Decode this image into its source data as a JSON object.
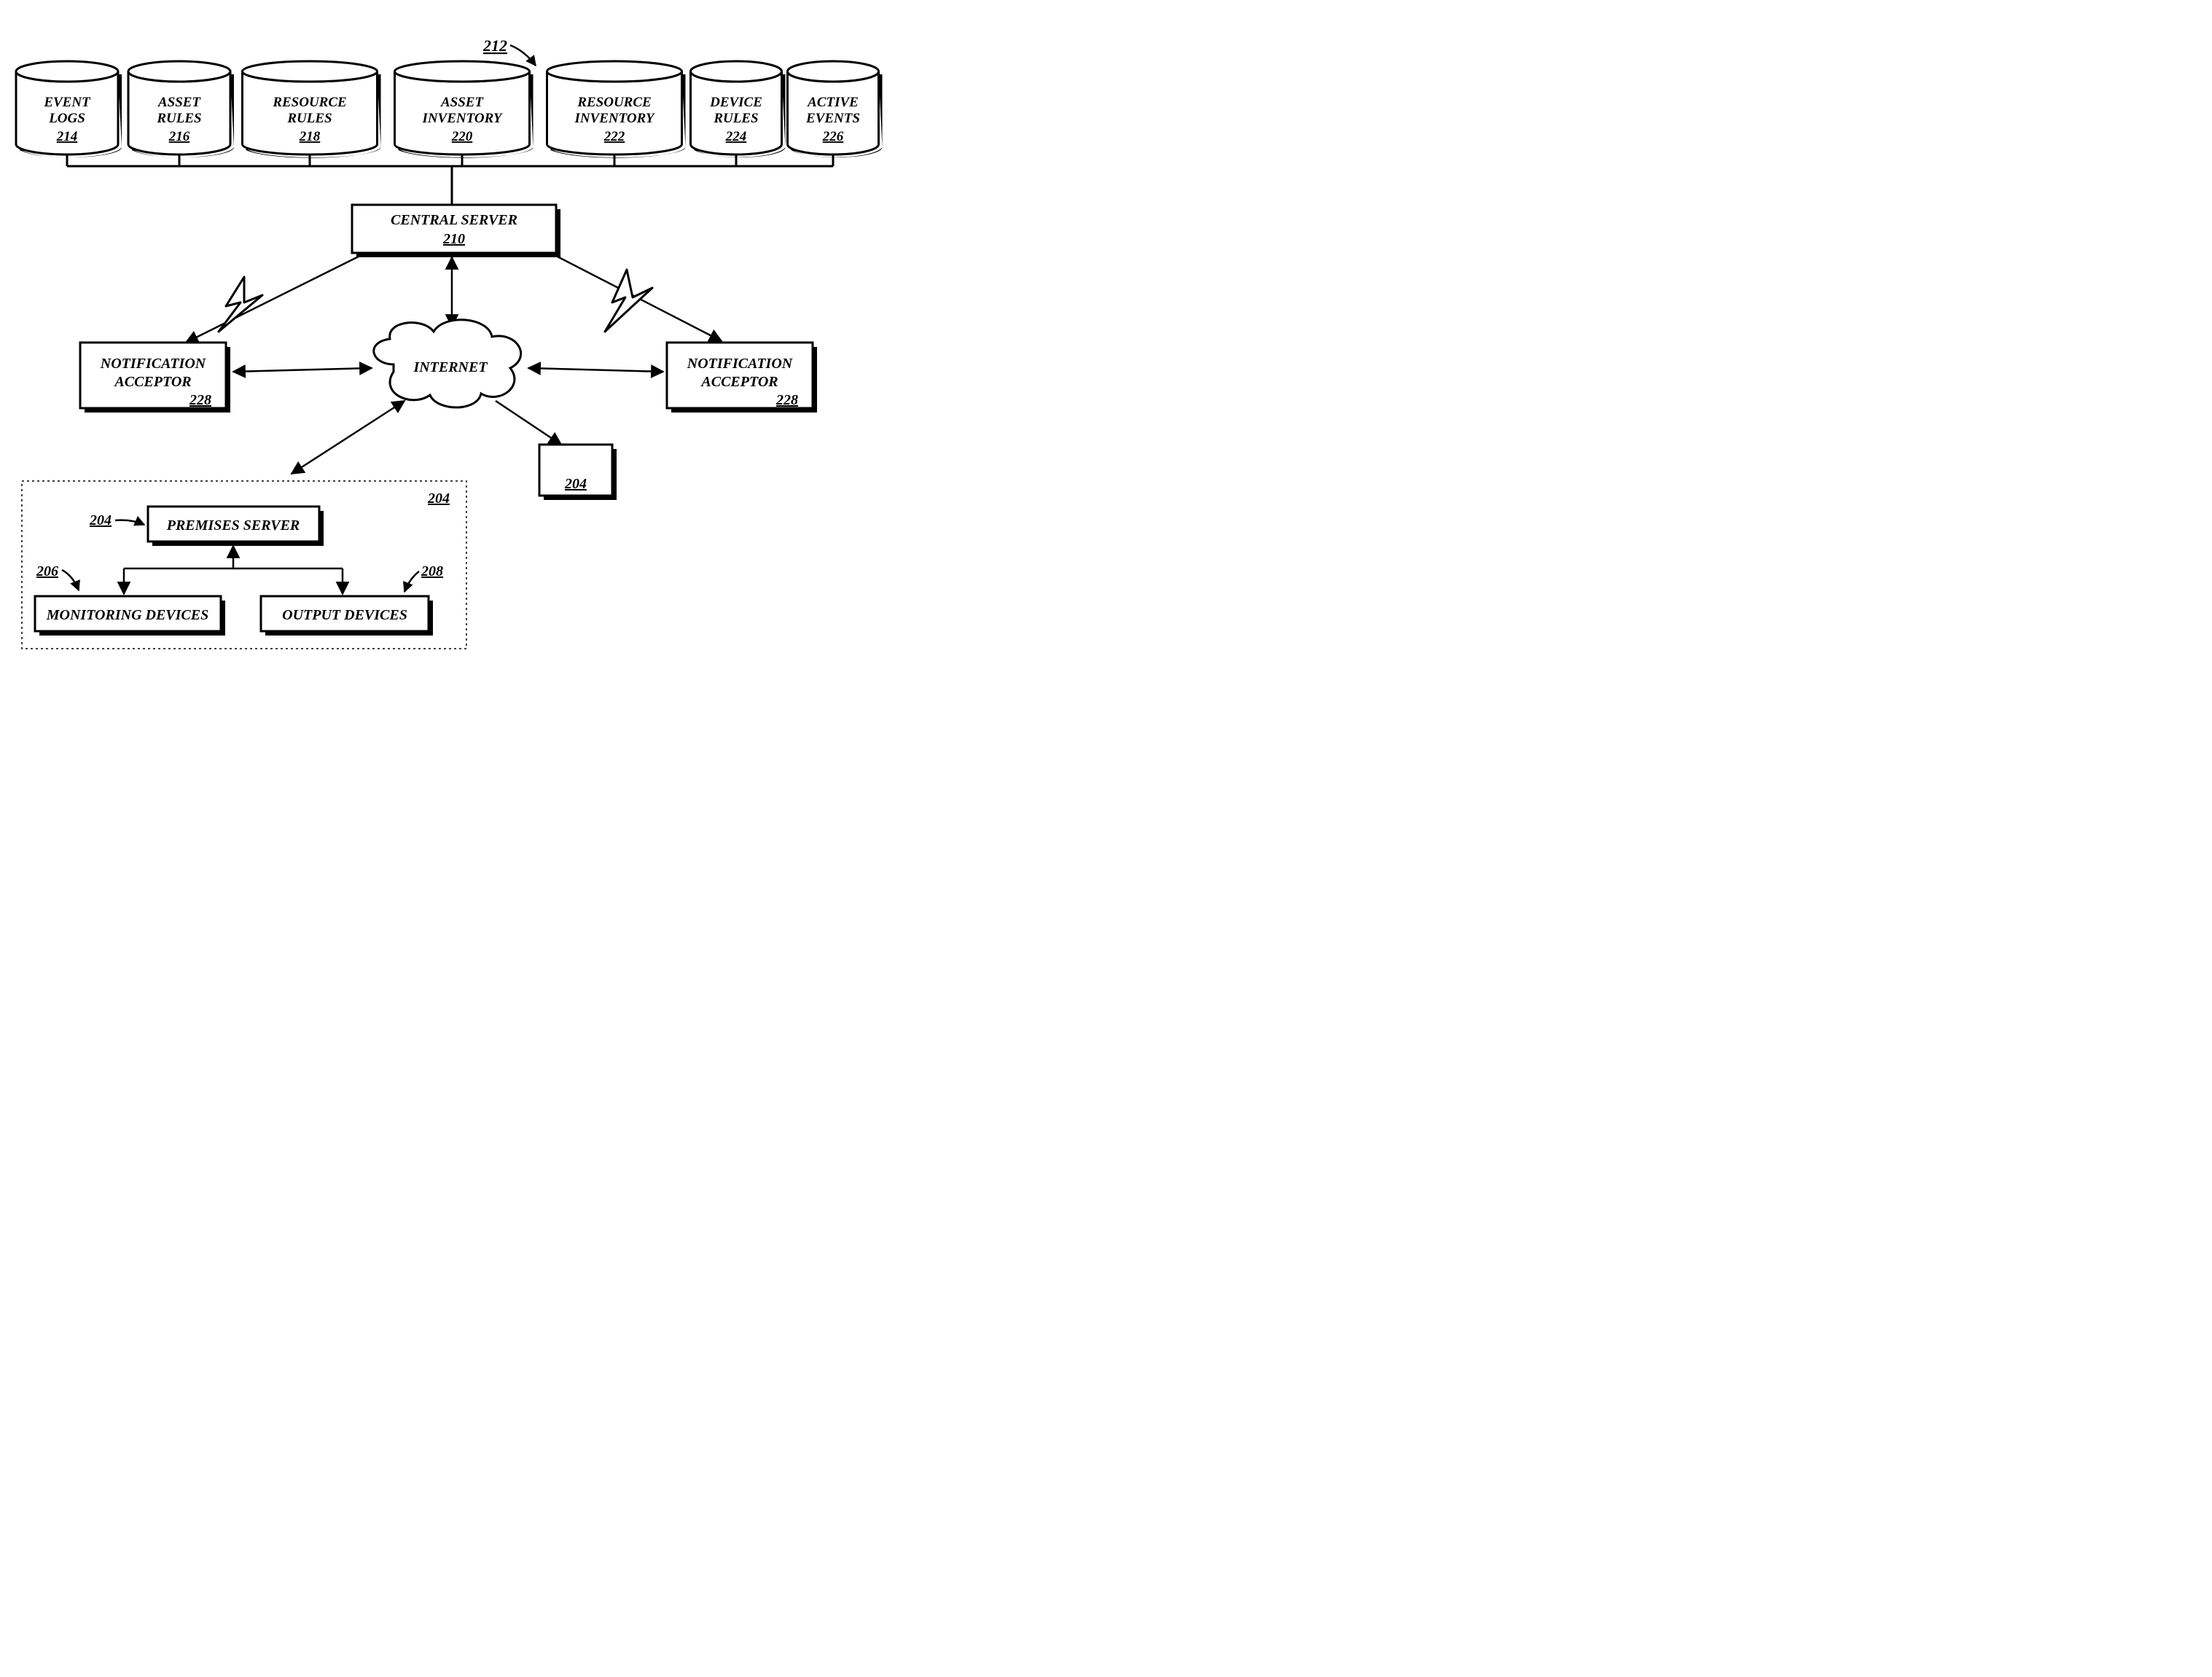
{
  "databases": [
    {
      "label": "EVENT LOGS",
      "num": "214"
    },
    {
      "label": "ASSET RULES",
      "num": "216"
    },
    {
      "label": "RESOURCE RULES",
      "num": "218"
    },
    {
      "label": "ASSET INVENTORY",
      "num": "220"
    },
    {
      "label": "RESOURCE INVENTORY",
      "num": "222"
    },
    {
      "label": "DEVICE RULES",
      "num": "224"
    },
    {
      "label": "ACTIVE EVENTS",
      "num": "226"
    }
  ],
  "topRef": "212",
  "centralServer": {
    "label": "CENTRAL SERVER",
    "num": "210"
  },
  "internet": "INTERNET",
  "notifLeft": {
    "label1": "NOTIFICATION",
    "label2": "ACCEPTOR",
    "num": "228"
  },
  "notifRight": {
    "label1": "NOTIFICATION",
    "label2": "ACCEPTOR",
    "num": "228"
  },
  "premisesGroup": {
    "ref": "204",
    "groupRef": "204"
  },
  "premisesServer": {
    "label": "PREMISES SERVER"
  },
  "monitoringDevices": {
    "label": "MONITORING DEVICES",
    "ref": "206"
  },
  "outputDevices": {
    "label": "OUTPUT DEVICES",
    "ref": "208"
  },
  "otherBox": {
    "num": "204"
  }
}
